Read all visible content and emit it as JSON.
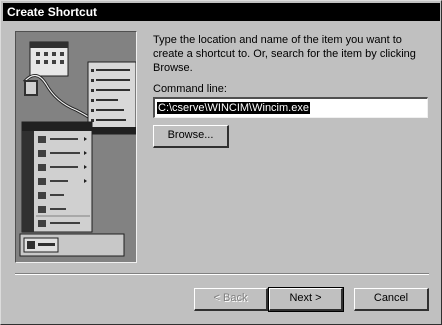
{
  "window": {
    "title": "Create Shortcut"
  },
  "instructions": "Type the location and name of the item you want to create a shortcut to. Or, search for the item by clicking Browse.",
  "command_line": {
    "label": "Command line:",
    "value": "C:\\cserve\\WINCIM\\Wincim.exe"
  },
  "buttons": {
    "browse": "Browse...",
    "back": "< Back",
    "next": "Next >",
    "cancel": "Cancel"
  }
}
